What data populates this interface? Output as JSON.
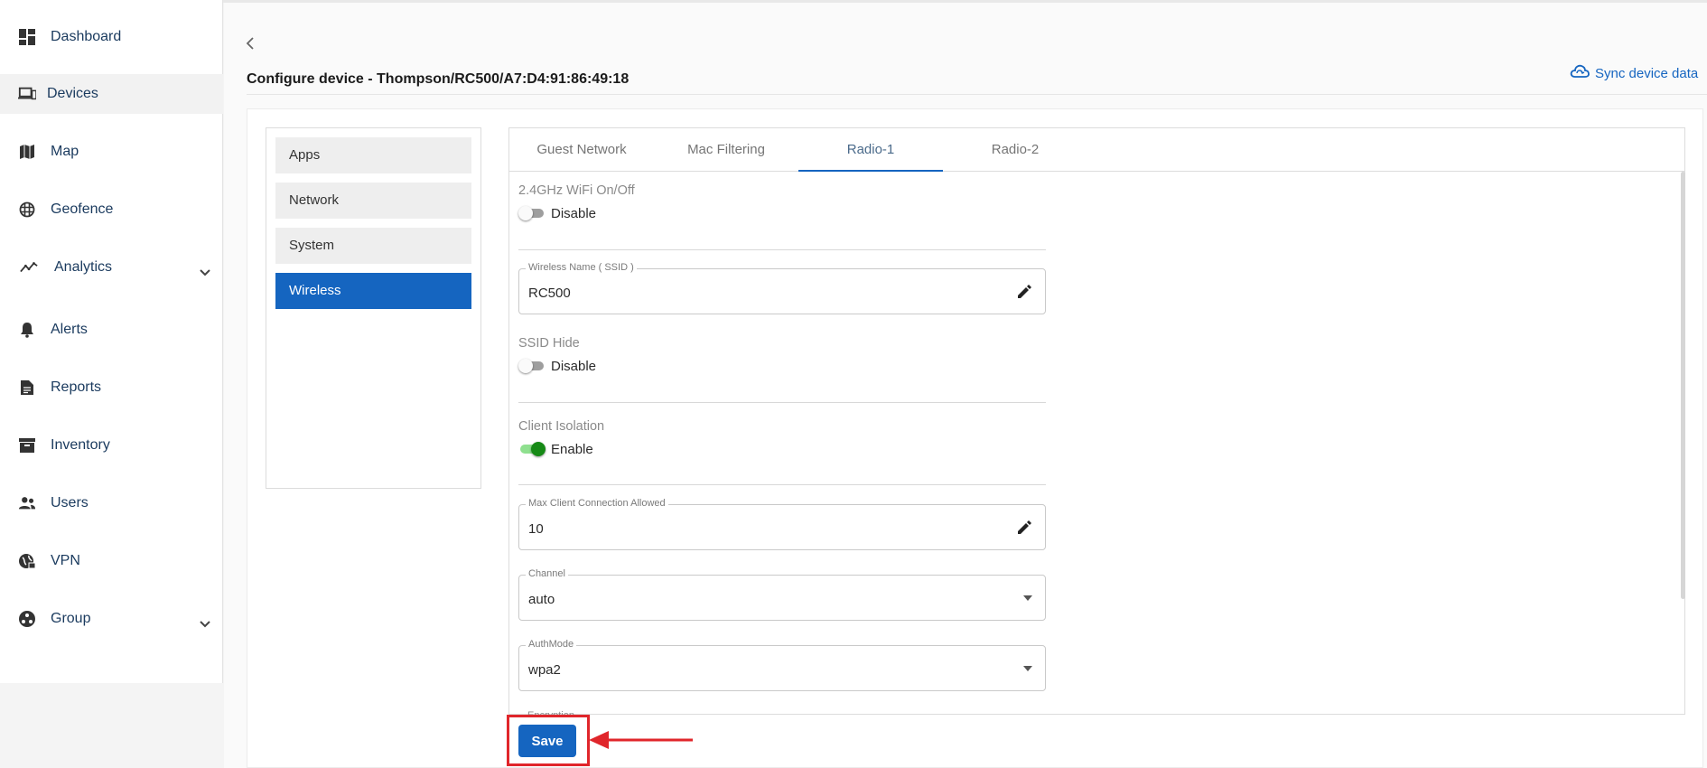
{
  "sidebar": {
    "items": [
      {
        "label": "Dashboard",
        "icon": "dashboard-icon"
      },
      {
        "label": "Devices",
        "icon": "devices-icon",
        "active": true
      },
      {
        "label": "Map",
        "icon": "map-icon"
      },
      {
        "label": "Geofence",
        "icon": "geofence-icon"
      },
      {
        "label": "Analytics",
        "icon": "analytics-icon",
        "expandable": true
      },
      {
        "label": "Alerts",
        "icon": "bell-icon"
      },
      {
        "label": "Reports",
        "icon": "reports-icon"
      },
      {
        "label": "Inventory",
        "icon": "inventory-icon"
      },
      {
        "label": "Users",
        "icon": "users-icon"
      },
      {
        "label": "VPN",
        "icon": "vpn-icon"
      },
      {
        "label": "Group",
        "icon": "group-icon",
        "expandable": true
      }
    ]
  },
  "header": {
    "title": "Configure device - Thompson/RC500/A7:D4:91:86:49:18",
    "sync_label": "Sync device data"
  },
  "menu": {
    "items": [
      {
        "label": "Apps"
      },
      {
        "label": "Network"
      },
      {
        "label": "System"
      },
      {
        "label": "Wireless",
        "active": true
      }
    ]
  },
  "tabs": [
    {
      "label": "Guest Network"
    },
    {
      "label": "Mac Filtering"
    },
    {
      "label": "Radio-1",
      "active": true
    },
    {
      "label": "Radio-2"
    }
  ],
  "form": {
    "wifi": {
      "label": "2.4GHz WiFi On/Off",
      "state": "Disable",
      "on": false
    },
    "ssid": {
      "legend": "Wireless Name ( SSID )",
      "value": "RC500"
    },
    "ssid_hide": {
      "label": "SSID Hide",
      "state": "Disable",
      "on": false
    },
    "client_isolation": {
      "label": "Client Isolation",
      "state": "Enable",
      "on": true
    },
    "max_clients": {
      "legend": "Max Client Connection Allowed",
      "value": "10"
    },
    "channel": {
      "legend": "Channel",
      "value": "auto"
    },
    "authmode": {
      "legend": "AuthMode",
      "value": "wpa2"
    },
    "encryption": {
      "legend": "Encryption"
    }
  },
  "actions": {
    "save_label": "Save"
  },
  "colors": {
    "primary": "#1565c0",
    "toggle_on": "#168a16",
    "highlight": "#e0262b",
    "nav_text": "#1a3a5e"
  }
}
